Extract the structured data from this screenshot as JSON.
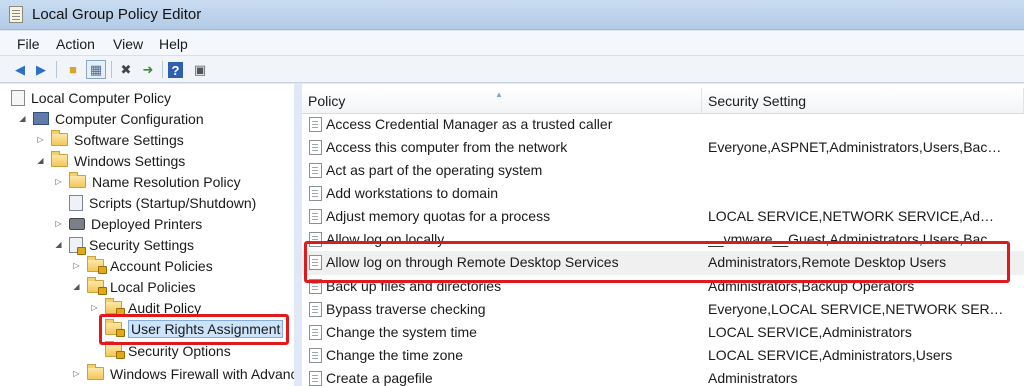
{
  "window": {
    "title": "Local Group Policy Editor"
  },
  "menu": [
    "File",
    "Action",
    "View",
    "Help"
  ],
  "toolbar": {
    "buttons": [
      "back-arrow-icon",
      "forward-arrow-icon",
      "up-folder-icon",
      "show-hide-tree-icon",
      "delete-icon",
      "export-list-icon",
      "help-icon",
      "properties-icon"
    ]
  },
  "tree": {
    "root": "Local Computer Policy",
    "computer_config": "Computer Configuration",
    "software_settings": "Software Settings",
    "windows_settings": "Windows Settings",
    "name_resolution": "Name Resolution Policy",
    "scripts": "Scripts (Startup/Shutdown)",
    "deployed_printers": "Deployed Printers",
    "security_settings": "Security Settings",
    "account_policies": "Account Policies",
    "local_policies": "Local Policies",
    "audit_policy": "Audit Policy",
    "user_rights": "User Rights Assignment",
    "security_options": "Security Options",
    "firewall": "Windows Firewall with Advanc"
  },
  "list": {
    "headers": {
      "policy": "Policy",
      "setting": "Security Setting"
    },
    "rows": [
      {
        "policy": "Access Credential Manager as a trusted caller",
        "setting": ""
      },
      {
        "policy": "Access this computer from the network",
        "setting": "Everyone,ASPNET,Administrators,Users,Backu..."
      },
      {
        "policy": "Act as part of the operating system",
        "setting": ""
      },
      {
        "policy": "Add workstations to domain",
        "setting": ""
      },
      {
        "policy": "Adjust memory quotas for a process",
        "setting": "LOCAL SERVICE,NETWORK SERVICE,Administ..."
      },
      {
        "policy": "Allow log on locally",
        "setting": "__vmware__Guest,Administrators,Users,Backu..."
      },
      {
        "policy": "Allow log on through Remote Desktop Services",
        "setting": "Administrators,Remote Desktop Users"
      },
      {
        "policy": "Back up files and directories",
        "setting": "Administrators,Backup Operators"
      },
      {
        "policy": "Bypass traverse checking",
        "setting": "Everyone,LOCAL SERVICE,NETWORK SERVICE..."
      },
      {
        "policy": "Change the system time",
        "setting": "LOCAL SERVICE,Administrators"
      },
      {
        "policy": "Change the time zone",
        "setting": "LOCAL SERVICE,Administrators,Users"
      },
      {
        "policy": "Create a pagefile",
        "setting": "Administrators"
      }
    ]
  },
  "colors": {
    "highlight_box": "#e0191c",
    "selection": "#cde3fa"
  }
}
